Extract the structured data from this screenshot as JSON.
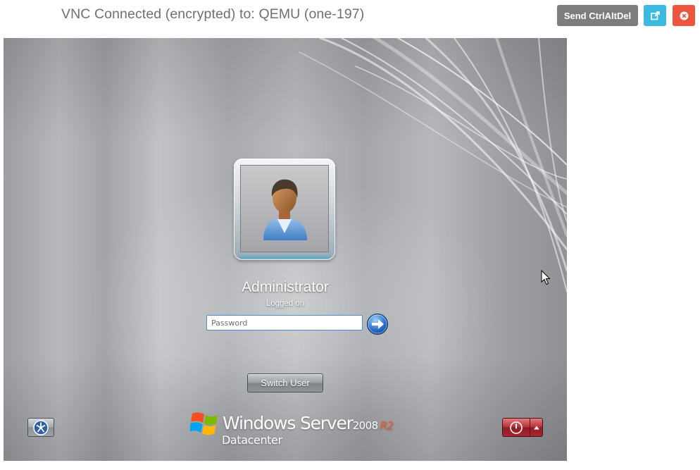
{
  "vnc": {
    "title": "VNC Connected (encrypted) to: QEMU (one-197)",
    "send_ctrlaltdel_label": "Send CtrlAltDel",
    "open_new_window_icon": "external-link-icon",
    "close_icon": "close-circle-icon",
    "colors": {
      "ctrlaltdel": "#7d7d7d",
      "external": "#3cb9e0",
      "close": "#ee5541"
    }
  },
  "login": {
    "user_name": "Administrator",
    "user_status": "Logged on",
    "password_placeholder": "Password",
    "password_value": "",
    "submit_icon": "arrow-right-icon",
    "switch_user_label": "Switch User",
    "ease_of_access_icon": "ease-of-access-icon",
    "shutdown_icon": "power-icon",
    "shutdown_options_icon": "triangle-up-icon"
  },
  "branding": {
    "product": "Windows Server",
    "version": "2008",
    "release": "R2",
    "edition": "Datacenter",
    "release_color": "#f0562a"
  }
}
